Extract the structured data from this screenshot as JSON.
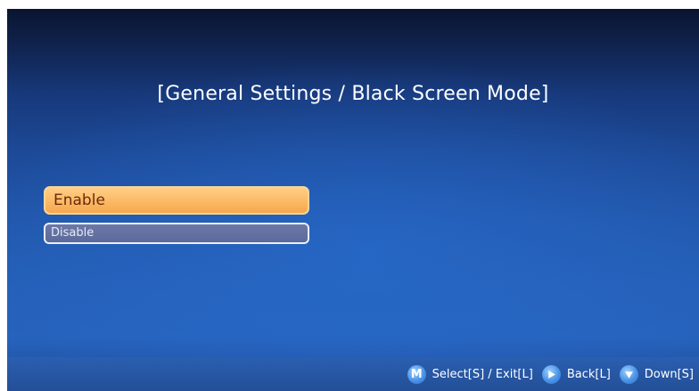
{
  "screen": {
    "title": "[General Settings / Black Screen Mode]"
  },
  "menu": {
    "items": [
      {
        "label": "Enable",
        "selected": true
      },
      {
        "label": "Disable",
        "selected": false
      }
    ]
  },
  "hints": {
    "select": {
      "icon": "m-button-icon",
      "glyph": "M",
      "label": "Select[S] / Exit[L]"
    },
    "back": {
      "icon": "play-right-icon",
      "label": "Back[L]"
    },
    "down": {
      "icon": "arrow-down-icon",
      "label": "Down[S]"
    }
  },
  "colors": {
    "selected_fill": "#fbb965",
    "selected_text": "#6a2a0c",
    "normal_fill": "#5c699b",
    "background": "#2258ad"
  }
}
